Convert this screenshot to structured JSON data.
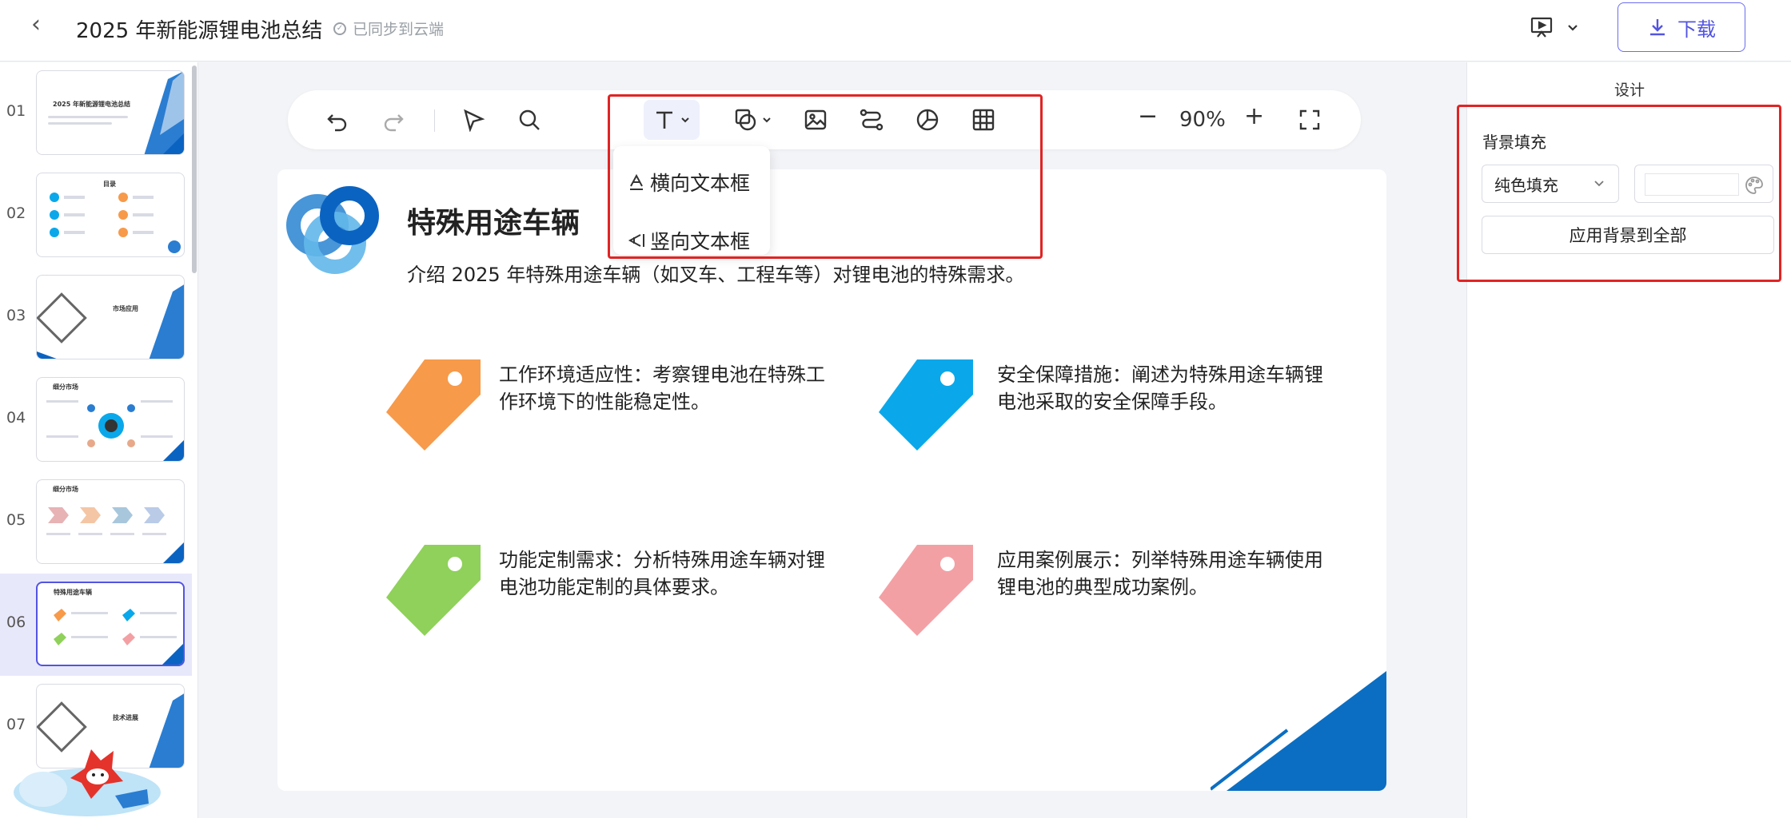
{
  "header": {
    "back_glyph": "‹",
    "title": "2025 年新能源锂电池总结",
    "sync_status": "已同步到云端",
    "download_label": "下载"
  },
  "thumbnails": [
    {
      "num": "01",
      "title": "2025 年新能源锂电池总结"
    },
    {
      "num": "02",
      "title": "目录"
    },
    {
      "num": "03",
      "title": "市场应用"
    },
    {
      "num": "04",
      "title": "细分市场"
    },
    {
      "num": "05",
      "title": "细分市场"
    },
    {
      "num": "06",
      "title": "特殊用途车辆",
      "active": true
    },
    {
      "num": "07",
      "title": "技术进展"
    }
  ],
  "toolbar": {
    "zoom_value": "90%",
    "zoom_minus": "−",
    "zoom_plus": "+"
  },
  "text_dropdown": {
    "items": [
      "横向文本框",
      "竖向文本框"
    ]
  },
  "slide": {
    "title": "特殊用途车辆",
    "subtitle": "介绍 2025 年特殊用途车辆（如叉车、工程车等）对锂电池的特殊需求。",
    "cards": [
      {
        "text": "工作环境适应性：考察锂电池在特殊工作环境下的性能稳定性。",
        "color": "#f79a4a"
      },
      {
        "text": "安全保障措施：阐述为特殊用途车辆锂电池采取的安全保障手段。",
        "color": "#0aa8ea"
      },
      {
        "text": "功能定制需求：分析特殊用途车辆对锂电池功能定制的具体要求。",
        "color": "#8fd15a"
      },
      {
        "text": "应用案例展示：列举特殊用途车辆使用锂电池的典型成功案例。",
        "color": "#f3a0a4"
      }
    ],
    "accent": "#0b6ec2"
  },
  "design_panel": {
    "title": "设计",
    "bg_fill_label": "背景填充",
    "fill_type": "纯色填充",
    "apply_all_label": "应用背景到全部"
  },
  "colors": {
    "highlight_red": "#e02424",
    "primary": "#5354e0"
  }
}
